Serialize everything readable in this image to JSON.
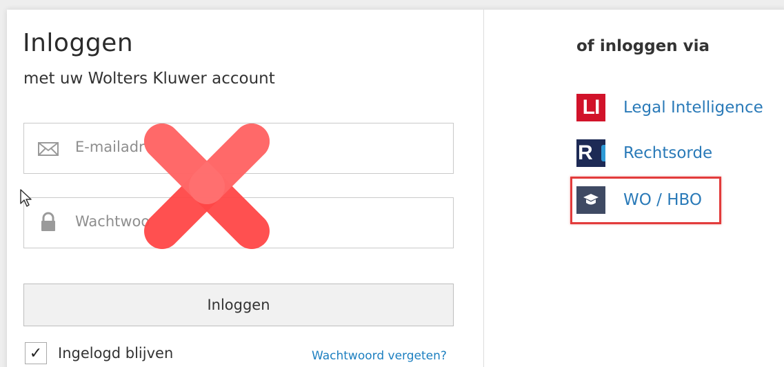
{
  "login": {
    "title": "Inloggen",
    "subtitle": "met uw Wolters Kluwer account",
    "email_placeholder": "E-mailadr",
    "password_placeholder": "Wachtwoo",
    "submit_label": "Inloggen",
    "remember_label": "Ingelogd blijven",
    "remember_checked": true,
    "checkmark": "✓",
    "forgot_label": "Wachtwoord vergeten?"
  },
  "alternative": {
    "title": "of inloggen via",
    "providers": [
      {
        "logo_text": "LI",
        "label": "Legal Intelligence",
        "icon": "legal-intelligence-logo"
      },
      {
        "logo_text": "R",
        "label": "Rechtsorde",
        "icon": "rechtsorde-logo"
      },
      {
        "logo_text": "",
        "label": "WO / HBO",
        "icon": "graduation-cap-icon",
        "highlighted": true
      }
    ]
  },
  "colors": {
    "link": "#1c7fc0",
    "provider_text": "#2a7ab8",
    "highlight": "#e23b3b",
    "overlay_x": "#ff4747",
    "li_red": "#d1132a",
    "ro_navy": "#1d2a55",
    "wo_slate": "#3f4a63"
  }
}
